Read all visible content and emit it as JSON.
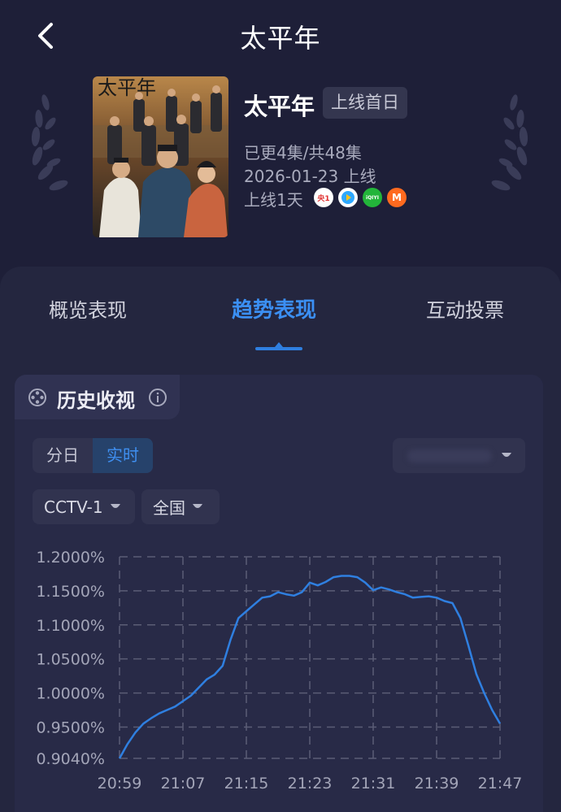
{
  "header": {
    "title": "太平年",
    "back_icon": "chevron-left-icon"
  },
  "show": {
    "name": "太平年",
    "badge": "上线首日",
    "episodes": "已更4集/共48集",
    "release": "2026-01-23 上线",
    "online_days": "上线1天",
    "poster_title": "太平年",
    "platforms": [
      {
        "name": "cctv1-logo",
        "label": "央1",
        "color": "#e03030"
      },
      {
        "name": "tencent-video-logo",
        "label": "",
        "color": "#2ea8ff"
      },
      {
        "name": "iqiyi-logo",
        "label": "iQIYI",
        "color": "#23b53a"
      },
      {
        "name": "mgtv-logo",
        "label": "M",
        "color": "#ff6a1f"
      }
    ]
  },
  "tabs": [
    {
      "label": "概览表现",
      "active": false
    },
    {
      "label": "趋势表现",
      "active": true
    },
    {
      "label": "互动投票",
      "active": false
    }
  ],
  "card": {
    "title": "历史收视",
    "segment": {
      "options": [
        "分日",
        "实时"
      ],
      "active": "实时"
    },
    "channel": "CCTV-1",
    "region": "全国"
  },
  "colors": {
    "accent": "#3b8ff3",
    "line": "#2f7fe0",
    "background": "#1e1f38"
  },
  "chart_data": {
    "type": "line",
    "x_ticks": [
      "20:59",
      "21:07",
      "21:15",
      "21:23",
      "21:31",
      "21:39",
      "21:47"
    ],
    "y_ticks": [
      "1.2000%",
      "1.1500%",
      "1.1000%",
      "1.0500%",
      "1.0000%",
      "0.9500%",
      "0.9040%"
    ],
    "y_tick_values": [
      1.2,
      1.15,
      1.1,
      1.05,
      1.0,
      0.95,
      0.904
    ],
    "ylim": [
      0.904,
      1.2
    ],
    "xlim_minutes": [
      0,
      48
    ],
    "grid": true,
    "series": [
      {
        "x": [
          0,
          1,
          2,
          3,
          4,
          5,
          6,
          7,
          8,
          9,
          10,
          11,
          12,
          13,
          14,
          15,
          16,
          17,
          18,
          19,
          20,
          21,
          22,
          23,
          24,
          25,
          26,
          27,
          28,
          29,
          30,
          31,
          32,
          33,
          34,
          35,
          36,
          37,
          38,
          39,
          40,
          41,
          42,
          43,
          44,
          45,
          46,
          47,
          48
        ],
        "y": [
          0.904,
          0.925,
          0.942,
          0.955,
          0.963,
          0.97,
          0.975,
          0.98,
          0.988,
          0.996,
          1.008,
          1.02,
          1.027,
          1.04,
          1.078,
          1.11,
          1.12,
          1.13,
          1.14,
          1.142,
          1.148,
          1.145,
          1.143,
          1.148,
          1.162,
          1.158,
          1.163,
          1.17,
          1.172,
          1.172,
          1.17,
          1.162,
          1.151,
          1.155,
          1.152,
          1.148,
          1.145,
          1.14,
          1.141,
          1.142,
          1.14,
          1.135,
          1.132,
          1.11,
          1.07,
          1.028,
          1.0,
          0.975,
          0.955
        ]
      }
    ]
  }
}
